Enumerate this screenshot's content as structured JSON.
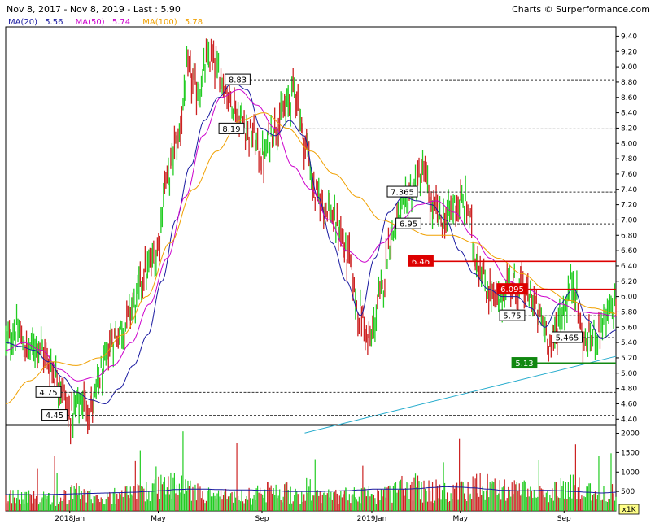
{
  "header": {
    "range_text": "Nov 8, 2017 - Nov 8, 2019 - Last : 5.90",
    "credit": "Charts © Surperformance.com"
  },
  "legend": [
    {
      "label": "MA(20)",
      "value": "5.56",
      "color": "#1a1aa0"
    },
    {
      "label": "MA(50)",
      "value": "5.74",
      "color": "#cc00cc"
    },
    {
      "label": "MA(100)",
      "value": "5.78",
      "color": "#f0a000"
    }
  ],
  "colors": {
    "up": "#22cc22",
    "down": "#cc2222",
    "ma20": "#1a1aa0",
    "ma50": "#cc00cc",
    "ma100": "#f0a000",
    "trendline": "#22aacc",
    "resistance": "#dd0000",
    "support": "#118811"
  },
  "chart_data": [
    {
      "type": "line",
      "title": "",
      "x_labels": [
        "2018Jan",
        "May",
        "Sep",
        "2019Jan",
        "May",
        "Sep"
      ],
      "ylim": [
        4.35,
        9.5
      ],
      "y_ticks": [
        "4.40",
        "4.60",
        "4.80",
        "5.00",
        "5.20",
        "5.40",
        "5.60",
        "5.80",
        "6.00",
        "6.20",
        "6.40",
        "6.60",
        "6.80",
        "7.00",
        "7.20",
        "7.40",
        "7.60",
        "7.80",
        "8.00",
        "8.20",
        "8.40",
        "8.60",
        "8.80",
        "9.00",
        "9.20",
        "9.40"
      ],
      "price_anchors": [
        5.4,
        5.55,
        5.3,
        5.4,
        5.15,
        4.9,
        4.45,
        4.65,
        4.55,
        5.0,
        5.45,
        5.6,
        5.9,
        6.3,
        6.5,
        7.5,
        8.0,
        8.9,
        8.7,
        9.1,
        8.9,
        8.6,
        8.3,
        8.1,
        7.8,
        8.2,
        8.4,
        8.7,
        8.0,
        7.3,
        7.2,
        6.9,
        6.5,
        5.8,
        5.4,
        6.0,
        6.8,
        7.1,
        7.4,
        7.6,
        7.1,
        7.0,
        7.2,
        7.2,
        6.5,
        6.1,
        5.9,
        6.2,
        6.1,
        6.0,
        5.7,
        5.4,
        5.8,
        6.2,
        5.4,
        5.5,
        5.7,
        5.9
      ],
      "series": [
        {
          "name": "MA(20)",
          "anchors": [
            5.4,
            5.35,
            5.3,
            5.15,
            4.95,
            4.75,
            4.65,
            4.6,
            4.8,
            5.1,
            5.5,
            6.2,
            7.0,
            7.7,
            8.3,
            8.6,
            8.8,
            8.7,
            8.2,
            8.1,
            8.3,
            8.1,
            7.3,
            6.7,
            6.2,
            5.75,
            6.5,
            7.1,
            7.3,
            7.25,
            7.2,
            7.0,
            6.6,
            6.3,
            6.1,
            6.0,
            6.0,
            5.85,
            5.6,
            5.9,
            6.1,
            5.7,
            5.45,
            5.56
          ]
        },
        {
          "name": "MA(50)",
          "anchors": [
            5.3,
            5.4,
            5.3,
            5.05,
            4.9,
            4.95,
            5.1,
            5.4,
            5.9,
            6.5,
            7.3,
            8.1,
            8.6,
            8.7,
            8.5,
            8.2,
            7.7,
            7.4,
            7.0,
            6.6,
            6.45,
            6.7,
            7.0,
            7.2,
            7.25,
            7.1,
            6.8,
            6.5,
            6.2,
            6.1,
            6.0,
            5.9,
            5.8,
            5.78,
            5.74
          ]
        },
        {
          "name": "MA(100)",
          "anchors": [
            4.6,
            4.9,
            5.15,
            5.1,
            5.2,
            5.5,
            6.0,
            6.7,
            7.4,
            7.9,
            8.3,
            8.4,
            8.2,
            7.9,
            7.6,
            7.3,
            7.0,
            6.9,
            6.8,
            6.8,
            6.7,
            6.5,
            6.3,
            6.1,
            5.95,
            5.85,
            5.78
          ]
        }
      ],
      "levels": [
        {
          "value": 8.83,
          "label": "8.83",
          "style": "dashed",
          "label_pos": 0.38
        },
        {
          "value": 8.19,
          "label": "8.19",
          "style": "dashed",
          "label_pos": 0.37
        },
        {
          "value": 7.365,
          "label": "7.365",
          "style": "dashed",
          "label_pos": 0.65
        },
        {
          "value": 6.95,
          "label": "6.95",
          "style": "dashed",
          "label_pos": 0.66
        },
        {
          "value": 6.46,
          "label": "6.46",
          "style": "red",
          "label_pos": 0.68
        },
        {
          "value": 6.095,
          "label": "6.095",
          "style": "red",
          "label_pos": 0.83
        },
        {
          "value": 5.75,
          "label": "5.75",
          "style": "dashed",
          "label_pos": 0.83
        },
        {
          "value": 5.465,
          "label": "5.465",
          "style": "dashed",
          "label_pos": 0.92
        },
        {
          "value": 5.13,
          "label": "5.13",
          "style": "green",
          "label_pos": 0.85
        },
        {
          "value": 4.75,
          "label": "4.75",
          "style": "dashed",
          "label_pos": 0.07
        },
        {
          "value": 4.45,
          "label": "4.45",
          "style": "dashed",
          "label_pos": 0.08
        }
      ],
      "trendline": {
        "from": [
          0.49,
          4.22
        ],
        "to": [
          1.0,
          5.22
        ]
      }
    },
    {
      "type": "bar",
      "title": "",
      "ylabel": "x1K",
      "ylim": [
        0,
        2200
      ],
      "y_ticks": [
        "500",
        "1000",
        "1500",
        "2000"
      ],
      "volume_anchors": [
        450,
        380,
        420,
        400,
        350,
        500,
        420,
        380,
        400,
        450,
        500,
        600,
        700,
        650,
        500,
        450,
        400,
        380,
        420,
        500,
        600,
        500,
        450,
        420,
        480,
        520,
        450,
        400,
        500,
        650,
        700,
        600,
        550,
        500,
        600,
        700,
        650,
        600,
        550,
        500,
        480,
        600,
        700,
        500,
        450,
        500
      ],
      "avg_volume_anchors": [
        420,
        420,
        410,
        420,
        430,
        440,
        450,
        460,
        470,
        480,
        500,
        520,
        550,
        560,
        560,
        550,
        540,
        540,
        530,
        520,
        500,
        500,
        500,
        510,
        520,
        540,
        560,
        560,
        560,
        570,
        600,
        620,
        610,
        590,
        560,
        530,
        520,
        520,
        530,
        520,
        500,
        480,
        460,
        480
      ]
    }
  ]
}
